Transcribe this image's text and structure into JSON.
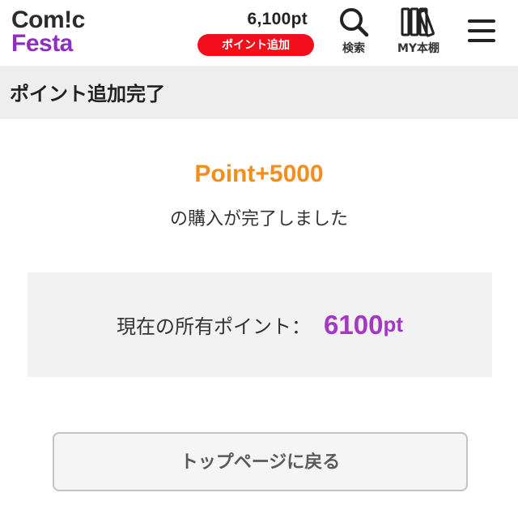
{
  "header": {
    "logo_line1": "Com!c",
    "logo_line2": "Festa",
    "points_value": "6,100pt",
    "add_points_label": "ポイント追加",
    "search_label": "検索",
    "shelf_label": "MY本棚",
    "icons": {
      "search": "search-icon",
      "shelf": "bookshelf-icon",
      "menu": "hamburger-menu-icon"
    }
  },
  "page": {
    "title": "ポイント追加完了"
  },
  "result": {
    "points_added": "Point+5000",
    "message": "の購入が完了しました"
  },
  "balance": {
    "label": "現在の所有ポイント：",
    "value": "6100",
    "unit": "pt"
  },
  "actions": {
    "back_to_top": "トップページに戻る"
  },
  "colors": {
    "brand_purple": "#8f2fc1",
    "add_button_red": "#f20f1b",
    "points_orange": "#f18e1e",
    "balance_purple": "#a437c4"
  }
}
